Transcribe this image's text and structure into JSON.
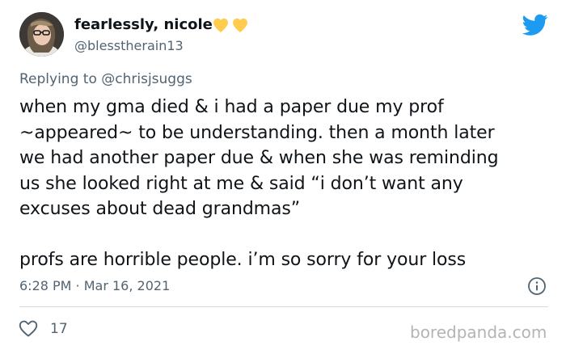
{
  "author": {
    "display_name": "fearlessly, nicole",
    "handle": "@blesstherain13",
    "avatar_icon": "profile-photo"
  },
  "icons": {
    "hearts": "yellow-heart-emoji-pair",
    "platform": "twitter-bird-icon",
    "info": "info-icon",
    "like": "heart-outline-icon"
  },
  "colors": {
    "twitter_blue": "#1d9bf0",
    "secondary_text": "#536471",
    "heart_yellow": "#ffcc4d"
  },
  "reply": {
    "prefix": "Replying to",
    "mention": "@chrisjsuggs"
  },
  "tweet": {
    "lines": [
      "when my gma died & i had a paper due my prof",
      "~appeared~ to be understanding. then a month later",
      "we had another paper due & when she was reminding",
      "us she looked right at me & said “i don’t want any",
      "excuses about dead grandmas”"
    ],
    "closing": "profs are horrible people. i’m so sorry for your loss"
  },
  "meta": {
    "timestamp": "6:28 PM · Mar 16, 2021",
    "like_count": "17"
  },
  "watermark": "boredpanda.com"
}
